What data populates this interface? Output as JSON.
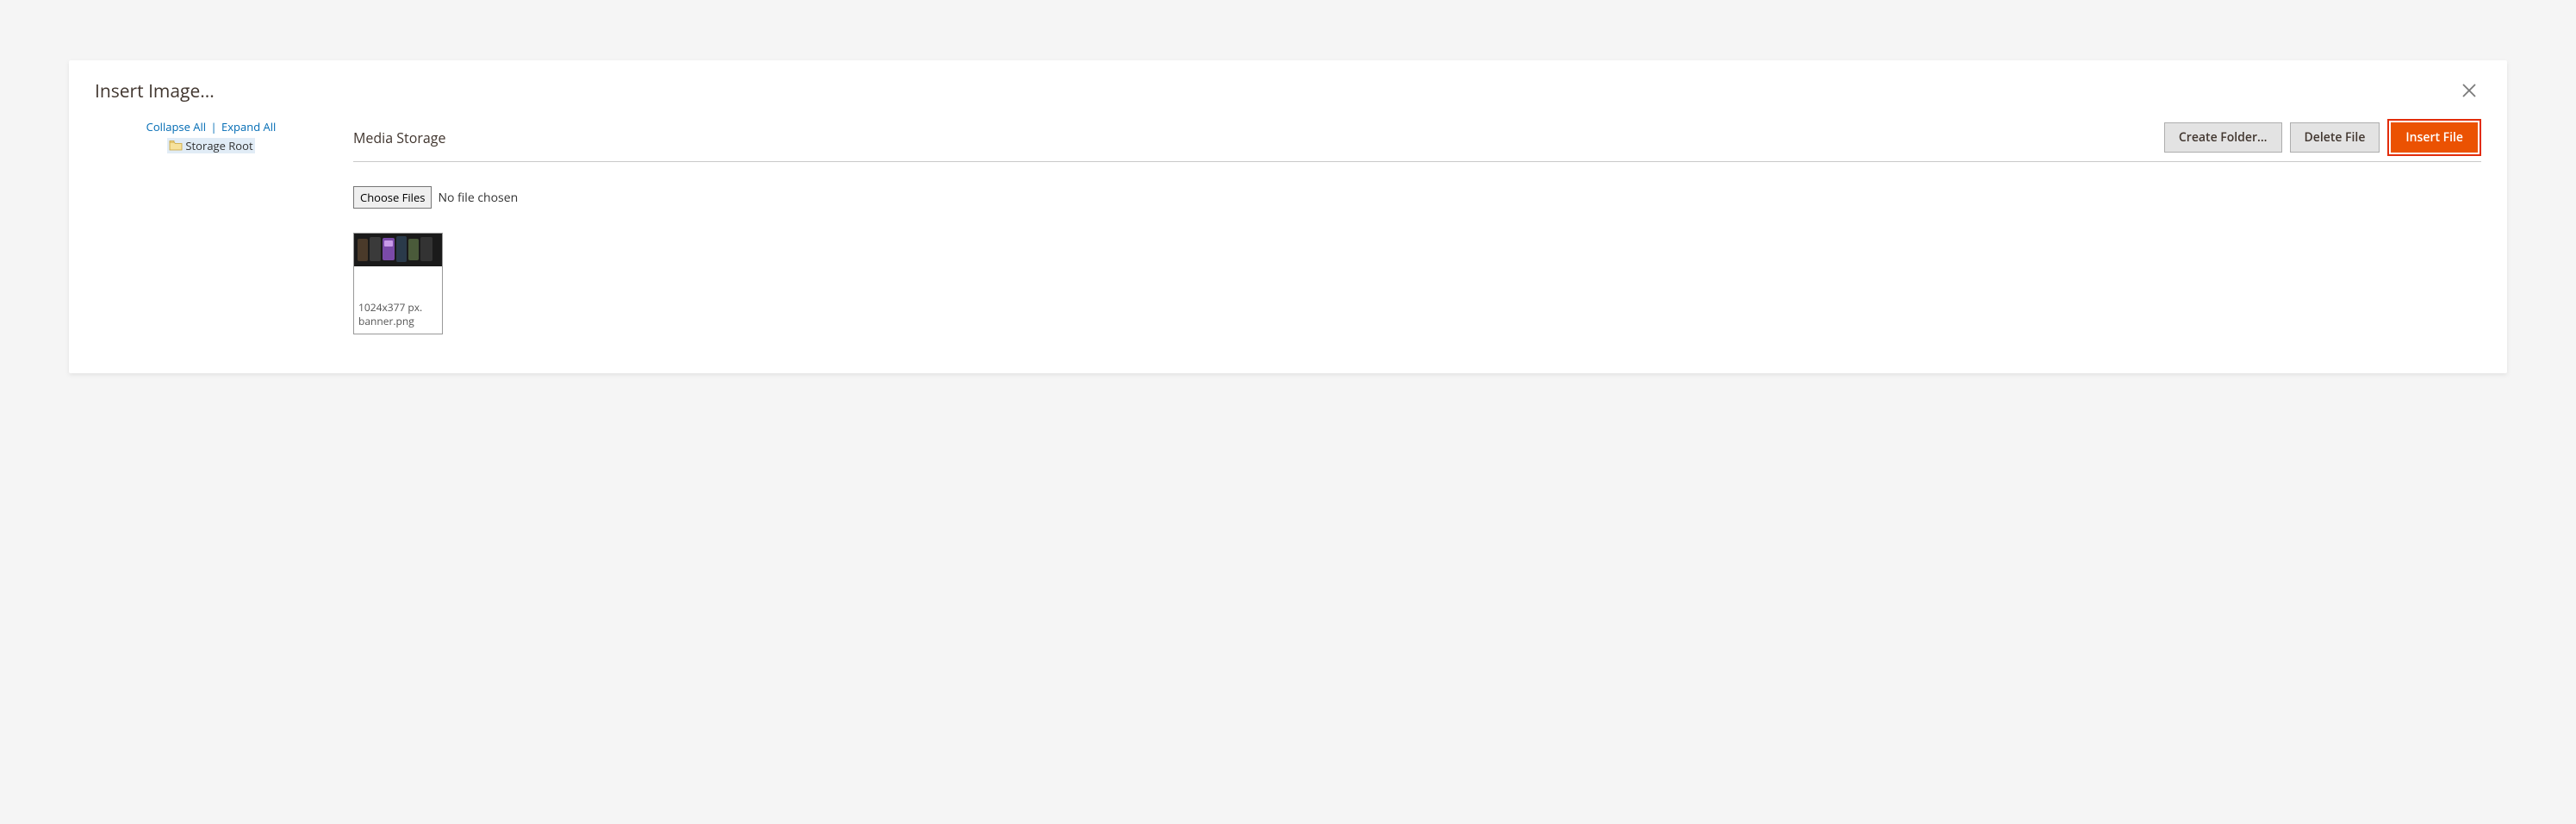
{
  "modal": {
    "title": "Insert Image..."
  },
  "tree": {
    "collapse_label": "Collapse All",
    "expand_label": "Expand All",
    "separator": "|",
    "root_label": "Storage Root"
  },
  "toolbar": {
    "heading": "Media Storage",
    "create_folder_label": "Create Folder...",
    "delete_file_label": "Delete File",
    "insert_file_label": "Insert File"
  },
  "upload": {
    "choose_label": "Choose Files",
    "no_file_label": "No file chosen"
  },
  "files": [
    {
      "dimensions": "1024x377 px.",
      "name": "banner.png"
    }
  ]
}
